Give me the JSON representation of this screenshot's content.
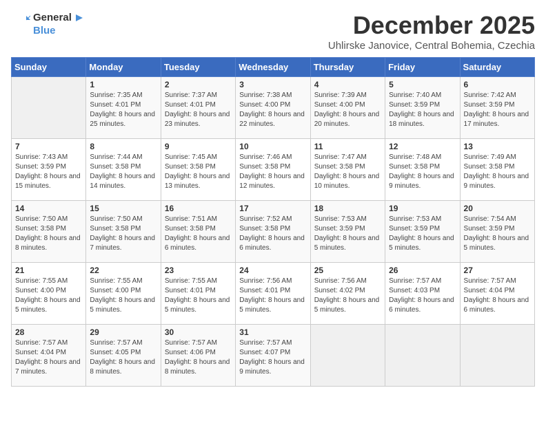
{
  "header": {
    "logo_general": "General",
    "logo_blue": "Blue",
    "month_year": "December 2025",
    "location": "Uhlirske Janovice, Central Bohemia, Czechia"
  },
  "weekdays": [
    "Sunday",
    "Monday",
    "Tuesday",
    "Wednesday",
    "Thursday",
    "Friday",
    "Saturday"
  ],
  "weeks": [
    [
      {
        "day": "",
        "sunrise": "",
        "sunset": "",
        "daylight": ""
      },
      {
        "day": "1",
        "sunrise": "Sunrise: 7:35 AM",
        "sunset": "Sunset: 4:01 PM",
        "daylight": "Daylight: 8 hours and 25 minutes."
      },
      {
        "day": "2",
        "sunrise": "Sunrise: 7:37 AM",
        "sunset": "Sunset: 4:01 PM",
        "daylight": "Daylight: 8 hours and 23 minutes."
      },
      {
        "day": "3",
        "sunrise": "Sunrise: 7:38 AM",
        "sunset": "Sunset: 4:00 PM",
        "daylight": "Daylight: 8 hours and 22 minutes."
      },
      {
        "day": "4",
        "sunrise": "Sunrise: 7:39 AM",
        "sunset": "Sunset: 4:00 PM",
        "daylight": "Daylight: 8 hours and 20 minutes."
      },
      {
        "day": "5",
        "sunrise": "Sunrise: 7:40 AM",
        "sunset": "Sunset: 3:59 PM",
        "daylight": "Daylight: 8 hours and 18 minutes."
      },
      {
        "day": "6",
        "sunrise": "Sunrise: 7:42 AM",
        "sunset": "Sunset: 3:59 PM",
        "daylight": "Daylight: 8 hours and 17 minutes."
      }
    ],
    [
      {
        "day": "7",
        "sunrise": "Sunrise: 7:43 AM",
        "sunset": "Sunset: 3:59 PM",
        "daylight": "Daylight: 8 hours and 15 minutes."
      },
      {
        "day": "8",
        "sunrise": "Sunrise: 7:44 AM",
        "sunset": "Sunset: 3:58 PM",
        "daylight": "Daylight: 8 hours and 14 minutes."
      },
      {
        "day": "9",
        "sunrise": "Sunrise: 7:45 AM",
        "sunset": "Sunset: 3:58 PM",
        "daylight": "Daylight: 8 hours and 13 minutes."
      },
      {
        "day": "10",
        "sunrise": "Sunrise: 7:46 AM",
        "sunset": "Sunset: 3:58 PM",
        "daylight": "Daylight: 8 hours and 12 minutes."
      },
      {
        "day": "11",
        "sunrise": "Sunrise: 7:47 AM",
        "sunset": "Sunset: 3:58 PM",
        "daylight": "Daylight: 8 hours and 10 minutes."
      },
      {
        "day": "12",
        "sunrise": "Sunrise: 7:48 AM",
        "sunset": "Sunset: 3:58 PM",
        "daylight": "Daylight: 8 hours and 9 minutes."
      },
      {
        "day": "13",
        "sunrise": "Sunrise: 7:49 AM",
        "sunset": "Sunset: 3:58 PM",
        "daylight": "Daylight: 8 hours and 9 minutes."
      }
    ],
    [
      {
        "day": "14",
        "sunrise": "Sunrise: 7:50 AM",
        "sunset": "Sunset: 3:58 PM",
        "daylight": "Daylight: 8 hours and 8 minutes."
      },
      {
        "day": "15",
        "sunrise": "Sunrise: 7:50 AM",
        "sunset": "Sunset: 3:58 PM",
        "daylight": "Daylight: 8 hours and 7 minutes."
      },
      {
        "day": "16",
        "sunrise": "Sunrise: 7:51 AM",
        "sunset": "Sunset: 3:58 PM",
        "daylight": "Daylight: 8 hours and 6 minutes."
      },
      {
        "day": "17",
        "sunrise": "Sunrise: 7:52 AM",
        "sunset": "Sunset: 3:58 PM",
        "daylight": "Daylight: 8 hours and 6 minutes."
      },
      {
        "day": "18",
        "sunrise": "Sunrise: 7:53 AM",
        "sunset": "Sunset: 3:59 PM",
        "daylight": "Daylight: 8 hours and 5 minutes."
      },
      {
        "day": "19",
        "sunrise": "Sunrise: 7:53 AM",
        "sunset": "Sunset: 3:59 PM",
        "daylight": "Daylight: 8 hours and 5 minutes."
      },
      {
        "day": "20",
        "sunrise": "Sunrise: 7:54 AM",
        "sunset": "Sunset: 3:59 PM",
        "daylight": "Daylight: 8 hours and 5 minutes."
      }
    ],
    [
      {
        "day": "21",
        "sunrise": "Sunrise: 7:55 AM",
        "sunset": "Sunset: 4:00 PM",
        "daylight": "Daylight: 8 hours and 5 minutes."
      },
      {
        "day": "22",
        "sunrise": "Sunrise: 7:55 AM",
        "sunset": "Sunset: 4:00 PM",
        "daylight": "Daylight: 8 hours and 5 minutes."
      },
      {
        "day": "23",
        "sunrise": "Sunrise: 7:55 AM",
        "sunset": "Sunset: 4:01 PM",
        "daylight": "Daylight: 8 hours and 5 minutes."
      },
      {
        "day": "24",
        "sunrise": "Sunrise: 7:56 AM",
        "sunset": "Sunset: 4:01 PM",
        "daylight": "Daylight: 8 hours and 5 minutes."
      },
      {
        "day": "25",
        "sunrise": "Sunrise: 7:56 AM",
        "sunset": "Sunset: 4:02 PM",
        "daylight": "Daylight: 8 hours and 5 minutes."
      },
      {
        "day": "26",
        "sunrise": "Sunrise: 7:57 AM",
        "sunset": "Sunset: 4:03 PM",
        "daylight": "Daylight: 8 hours and 6 minutes."
      },
      {
        "day": "27",
        "sunrise": "Sunrise: 7:57 AM",
        "sunset": "Sunset: 4:04 PM",
        "daylight": "Daylight: 8 hours and 6 minutes."
      }
    ],
    [
      {
        "day": "28",
        "sunrise": "Sunrise: 7:57 AM",
        "sunset": "Sunset: 4:04 PM",
        "daylight": "Daylight: 8 hours and 7 minutes."
      },
      {
        "day": "29",
        "sunrise": "Sunrise: 7:57 AM",
        "sunset": "Sunset: 4:05 PM",
        "daylight": "Daylight: 8 hours and 8 minutes."
      },
      {
        "day": "30",
        "sunrise": "Sunrise: 7:57 AM",
        "sunset": "Sunset: 4:06 PM",
        "daylight": "Daylight: 8 hours and 8 minutes."
      },
      {
        "day": "31",
        "sunrise": "Sunrise: 7:57 AM",
        "sunset": "Sunset: 4:07 PM",
        "daylight": "Daylight: 8 hours and 9 minutes."
      },
      {
        "day": "",
        "sunrise": "",
        "sunset": "",
        "daylight": ""
      },
      {
        "day": "",
        "sunrise": "",
        "sunset": "",
        "daylight": ""
      },
      {
        "day": "",
        "sunrise": "",
        "sunset": "",
        "daylight": ""
      }
    ]
  ]
}
